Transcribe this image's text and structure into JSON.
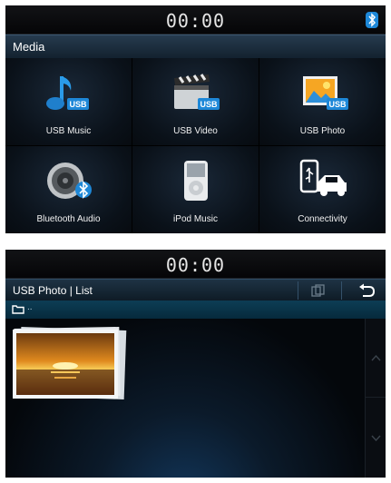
{
  "screen1": {
    "clock": "00:00",
    "title": "Media",
    "tiles": [
      {
        "label": "USB Music",
        "icon": "usb-music-icon"
      },
      {
        "label": "USB Video",
        "icon": "usb-video-icon"
      },
      {
        "label": "USB Photo",
        "icon": "usb-photo-icon"
      },
      {
        "label": "Bluetooth Audio",
        "icon": "bluetooth-audio-icon"
      },
      {
        "label": "iPod Music",
        "icon": "ipod-icon"
      },
      {
        "label": "Connectivity",
        "icon": "connectivity-icon"
      }
    ],
    "usb_badge": "USB",
    "status_icon": "bluetooth-icon"
  },
  "screen2": {
    "clock": "00:00",
    "title": "USB Photo | List",
    "path": "..",
    "buttons": {
      "copy": "copy-icon",
      "back": "back-icon"
    },
    "scroll": {
      "up": "chevron-up-icon",
      "down": "chevron-down-icon"
    }
  },
  "colors": {
    "accent": "#1e88d8",
    "header": "#1a2e40",
    "pathbar": "#0a3549"
  }
}
